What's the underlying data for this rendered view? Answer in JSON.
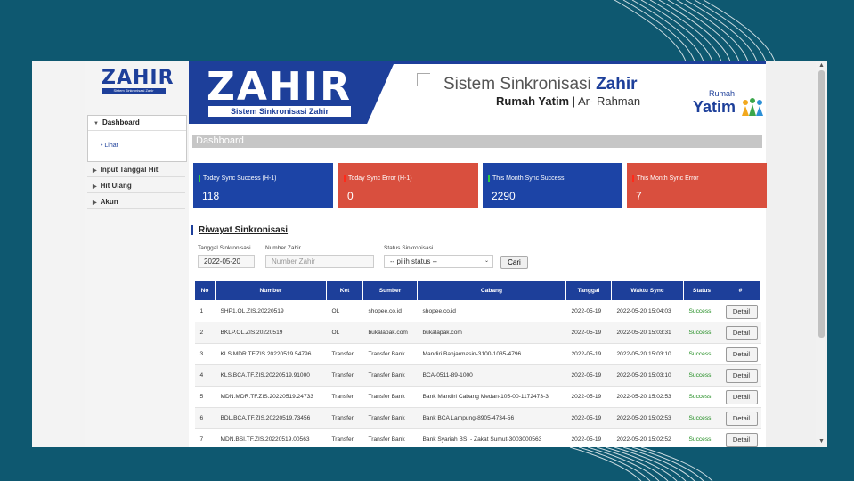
{
  "sidebar": {
    "logo": {
      "title": "ZAHIR",
      "subtitle": "Sistem Sinkronisasi Zahir"
    },
    "menu_open": {
      "label": "Dashboard",
      "sub": "Lihat"
    },
    "items": [
      {
        "label": "Input Tanggal Hit"
      },
      {
        "label": "Hit Ulang"
      },
      {
        "label": "Akun"
      }
    ]
  },
  "banner": {
    "logo_title": "ZAHIR",
    "logo_sub": "Sistem Sinkronisasi Zahir",
    "title_plain": "Sistem Sinkronisasi ",
    "title_bold": "Zahir",
    "org_bold": "Rumah Yatim",
    "org_rest": " | Ar- Rahman",
    "partner_top": "Rumah",
    "partner_main": "Yatim"
  },
  "page": {
    "title": "Dashboard"
  },
  "cards": [
    {
      "label": "Today Sync Success (H-1)",
      "value": "118",
      "color": "#1c44a6"
    },
    {
      "label": "Today Sync Error (H-1)",
      "value": "0",
      "color": "#d94f3e"
    },
    {
      "label": "This Month Sync Success",
      "value": "2290",
      "color": "#1c44a6"
    },
    {
      "label": "This Month Sync Error",
      "value": "7",
      "color": "#d94f3e"
    }
  ],
  "history": {
    "title": "Riwayat Sinkronisasi",
    "filters": {
      "date_label": "Tanggal Sinkronisasi",
      "date_value": "2022-05-20",
      "number_label": "Number Zahir",
      "number_placeholder": "Number Zahir",
      "status_label": "Status Sinkronisasi",
      "status_value": "-- pilih status --",
      "search_button": "Cari"
    },
    "columns": [
      "No",
      "Number",
      "Ket",
      "Sumber",
      "Cabang",
      "Tanggal",
      "Waktu Sync",
      "Status",
      "#"
    ],
    "rows": [
      {
        "no": "1",
        "number": "SHP1.OL.ZIS.20220519",
        "ket": "OL",
        "sumber": "shopee.co.id",
        "cabang": "shopee.co.id",
        "tanggal": "2022-05-19",
        "waktu": "2022-05-20 15:04:03",
        "status": "Success",
        "action": "Detail"
      },
      {
        "no": "2",
        "number": "BKLP.OL.ZIS.20220519",
        "ket": "OL",
        "sumber": "bukalapak.com",
        "cabang": "bukalapak.com",
        "tanggal": "2022-05-19",
        "waktu": "2022-05-20 15:03:31",
        "status": "Success",
        "action": "Detail"
      },
      {
        "no": "3",
        "number": "KLS.MDR.TF.ZIS.20220519.54796",
        "ket": "Transfer",
        "sumber": "Transfer Bank",
        "cabang": "Mandiri Banjarmasin-3100-1035-4796",
        "tanggal": "2022-05-19",
        "waktu": "2022-05-20 15:03:10",
        "status": "Success",
        "action": "Detail"
      },
      {
        "no": "4",
        "number": "KLS.BCA.TF.ZIS.20220519.91000",
        "ket": "Transfer",
        "sumber": "Transfer Bank",
        "cabang": "BCA-0511-89-1000",
        "tanggal": "2022-05-19",
        "waktu": "2022-05-20 15:03:10",
        "status": "Success",
        "action": "Detail"
      },
      {
        "no": "5",
        "number": "MDN.MDR.TF.ZIS.20220519.24733",
        "ket": "Transfer",
        "sumber": "Transfer Bank",
        "cabang": "Bank Mandiri Cabang Medan-105-00-1172473-3",
        "tanggal": "2022-05-19",
        "waktu": "2022-05-20 15:02:53",
        "status": "Success",
        "action": "Detail"
      },
      {
        "no": "6",
        "number": "BDL.BCA.TF.ZIS.20220519.73456",
        "ket": "Transfer",
        "sumber": "Transfer Bank",
        "cabang": "Bank BCA Lampung-8905-4734-56",
        "tanggal": "2022-05-19",
        "waktu": "2022-05-20 15:02:53",
        "status": "Success",
        "action": "Detail"
      },
      {
        "no": "7",
        "number": "MDN.BSI.TF.ZIS.20220519.00563",
        "ket": "Transfer",
        "sumber": "Transfer Bank",
        "cabang": "Bank Syariah BSI - Zakat Sumut-3003000563",
        "tanggal": "2022-05-19",
        "waktu": "2022-05-20 15:02:52",
        "status": "Success",
        "action": "Detail"
      }
    ]
  }
}
